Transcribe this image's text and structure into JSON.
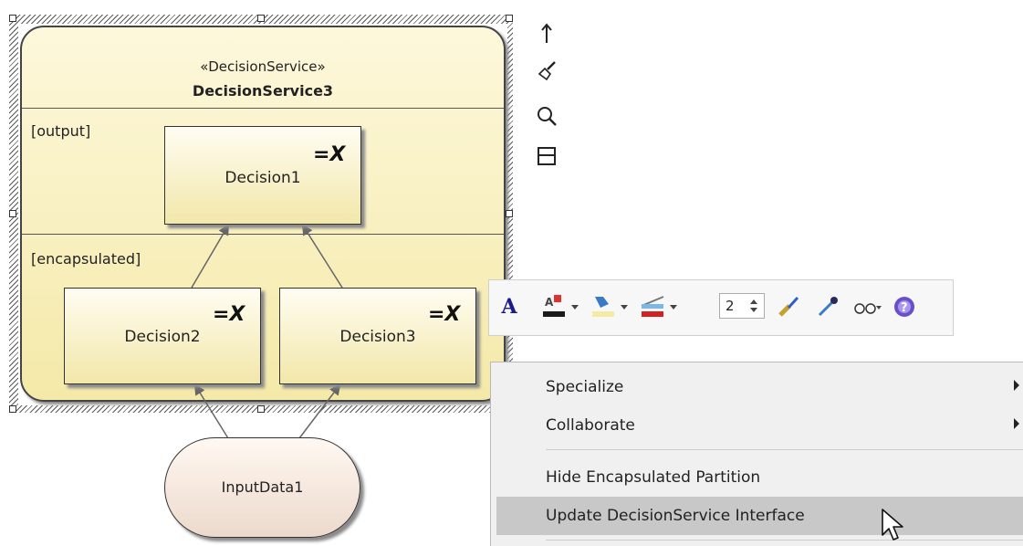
{
  "diagram": {
    "decision_service": {
      "stereotype": "«DecisionService»",
      "name": "DecisionService3",
      "output_label": "[output]",
      "encapsulated_label": "[encapsulated]"
    },
    "decisions": [
      {
        "name": "Decision1",
        "symbol": "=X"
      },
      {
        "name": "Decision2",
        "symbol": "=X"
      },
      {
        "name": "Decision3",
        "symbol": "=X"
      }
    ],
    "input_data": {
      "name": "InputData1"
    }
  },
  "side_tools": [
    {
      "icon": "arrow-up-icon"
    },
    {
      "icon": "paint-brush-icon"
    },
    {
      "icon": "magnifier-icon"
    },
    {
      "icon": "partition-icon"
    }
  ],
  "format_toolbar": {
    "line_width_value": "2",
    "colors": {
      "font": "#1a1a8c",
      "fill": "#f5e9a6",
      "line": "#d32020",
      "help": "#6a4fc8"
    }
  },
  "context_menu": {
    "items": [
      {
        "label": "Specialize",
        "submenu": true
      },
      {
        "label": "Collaborate",
        "submenu": true
      },
      {
        "label": "Hide Encapsulated Partition",
        "submenu": false
      },
      {
        "label": "Update DecisionService Interface",
        "submenu": false,
        "highlighted": true
      }
    ]
  }
}
